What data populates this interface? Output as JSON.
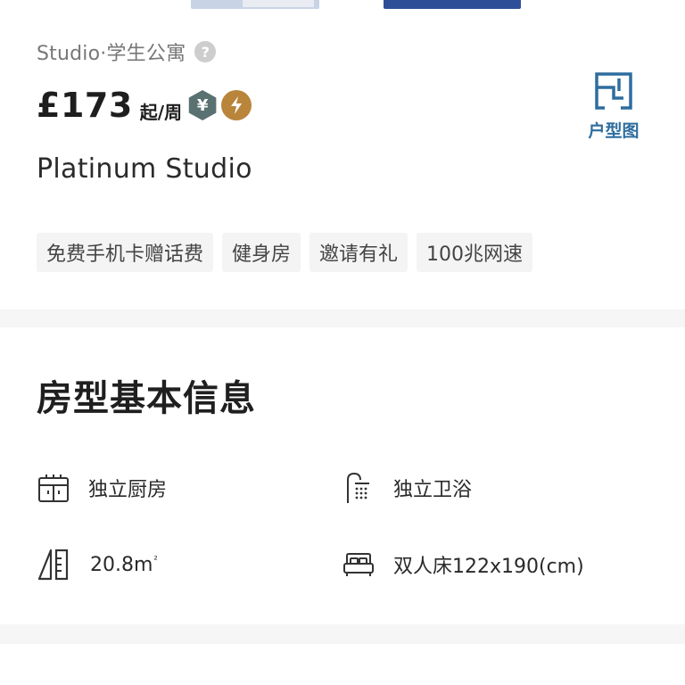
{
  "header": {
    "subtitle": "Studio·学生公寓",
    "help_icon": "help-icon",
    "price": "£173",
    "price_unit": "起/周",
    "badges": [
      "yuan-badge-icon",
      "flash-badge-icon"
    ],
    "floorplan_label": "户型图",
    "room_name": "Platinum Studio"
  },
  "tags": [
    "免费手机卡赠话费",
    "健身房",
    "邀请有礼",
    "100兆网速"
  ],
  "basic_info": {
    "title": "房型基本信息",
    "items": {
      "kitchen": "独立厨房",
      "bath": "独立卫浴",
      "area": "20.8m",
      "area_sup": "²",
      "bed": "双人床122x190(cm)"
    }
  },
  "colors": {
    "accent_blue": "#2e6d9e",
    "yuan_badge": "#5a7172",
    "flash_badge": "#b8853b",
    "tag_bg": "#f4f4f4",
    "divider": "#f6f6f6"
  }
}
